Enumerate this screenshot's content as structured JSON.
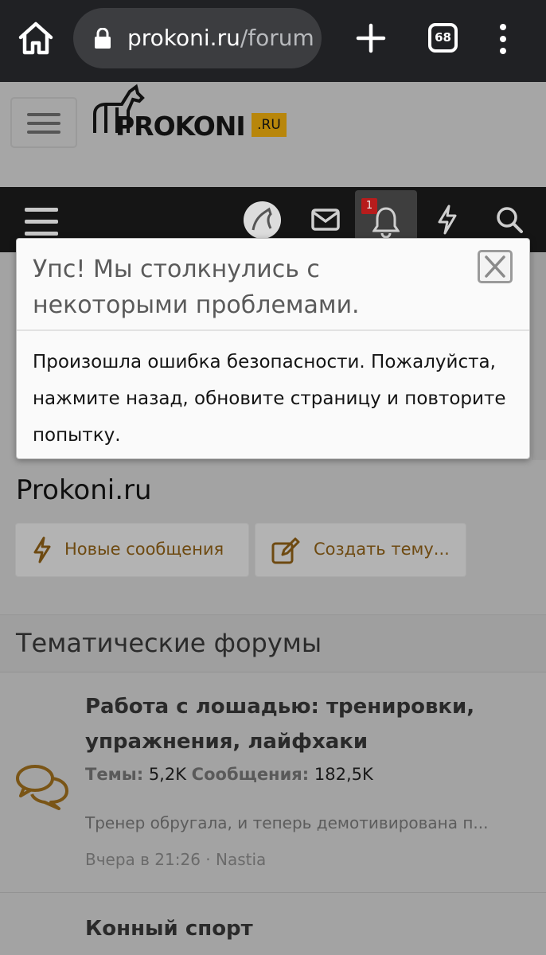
{
  "browser": {
    "url_host": "prokoni.ru",
    "url_path": "/forum",
    "tab_count": "68",
    "icons": [
      "home-icon",
      "lock-icon",
      "new-tab-icon",
      "more-icon"
    ]
  },
  "site": {
    "logo_word": "PROKONI",
    "logo_suffix": ".RU",
    "accent_color": "#b8860b"
  },
  "navbar": {
    "alerts_badge": "1",
    "icons": [
      "menu-icon",
      "avatar",
      "mail-icon",
      "bell-icon",
      "bolt-icon",
      "search-icon"
    ]
  },
  "modal": {
    "title": "Упс! Мы столкнулись с некоторыми проблемами.",
    "message": "Произошла ошибка безопасности. Пожалуйста, нажмите назад, обновите страницу и повторите попытку."
  },
  "page": {
    "title": "Prokoni.ru",
    "buttons": {
      "new_posts": "Новые сообщения",
      "create_thread": "Создать тему..."
    }
  },
  "section": {
    "title": "Тематические форумы",
    "forums": [
      {
        "title": "Работа с лошадью: тренировки, упражнения, лайфхаки",
        "threads_label": "Темы:",
        "threads_value": "5,2K",
        "posts_label": "Сообщения:",
        "posts_value": "182,5K",
        "last_post": "Тренер обругала, и теперь демотивирована п...",
        "last_time": "Вчера в 21:26",
        "last_user": "Nastia"
      },
      {
        "title": "Конный спорт"
      }
    ]
  }
}
